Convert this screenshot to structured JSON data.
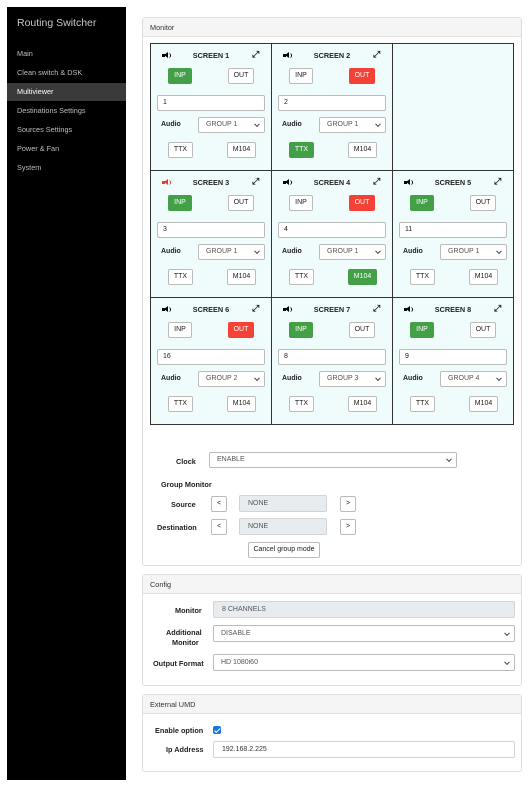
{
  "sidebar": {
    "brand": "Routing Switcher",
    "items": [
      {
        "label": "Main"
      },
      {
        "label": "Clean switch & DSK"
      },
      {
        "label": "Multiviewer"
      },
      {
        "label": "Destinations Settings"
      },
      {
        "label": "Sources Settings"
      },
      {
        "label": "Power & Fan"
      },
      {
        "label": "System"
      }
    ],
    "active_item": "Multiviewer"
  },
  "monitor": {
    "header": "Monitor",
    "inp_label": "INP",
    "out_label": "OUT",
    "audio_label": "Audio",
    "ttx_label": "TTX",
    "m104_label": "M104",
    "screens": [
      {
        "title": "SCREEN 1",
        "active": "INP",
        "channel": "1",
        "group": "GROUP 1",
        "ttx_on": false,
        "m104_on": false,
        "speaker_alert": false
      },
      {
        "title": "SCREEN 2",
        "active": "OUT",
        "channel": "2",
        "group": "GROUP 1",
        "ttx_on": true,
        "m104_on": false,
        "speaker_alert": false
      },
      {
        "title": "SCREEN 3",
        "active": "INP",
        "channel": "3",
        "group": "GROUP 1",
        "ttx_on": false,
        "m104_on": false,
        "speaker_alert": true
      },
      {
        "title": "SCREEN 4",
        "active": "OUT",
        "channel": "4",
        "group": "GROUP 1",
        "ttx_on": false,
        "m104_on": true,
        "speaker_alert": false
      },
      {
        "title": "SCREEN 5",
        "active": "INP",
        "channel": "11",
        "group": "GROUP 1",
        "ttx_on": false,
        "m104_on": false,
        "speaker_alert": false
      },
      {
        "title": "SCREEN 6",
        "active": "OUT",
        "channel": "16",
        "group": "GROUP 2",
        "ttx_on": false,
        "m104_on": false,
        "speaker_alert": false
      },
      {
        "title": "SCREEN 7",
        "active": "INP",
        "channel": "8",
        "group": "GROUP 3",
        "ttx_on": false,
        "m104_on": false,
        "speaker_alert": false
      },
      {
        "title": "SCREEN 8",
        "active": "INP",
        "channel": "9",
        "group": "GROUP 4",
        "ttx_on": false,
        "m104_on": false,
        "speaker_alert": false
      }
    ],
    "clock_label": "Clock",
    "clock_value": "ENABLE",
    "group_monitor_label": "Group Monitor",
    "source_label": "Source",
    "source_value": "NONE",
    "destination_label": "Destination",
    "destination_value": "NONE",
    "prev_label": "<",
    "next_label": ">",
    "cancel_label": "Cancel group mode"
  },
  "config": {
    "header": "Config",
    "monitor_label": "Monitor",
    "monitor_value": "8 CHANNELS",
    "additional_label_1": "Additional",
    "additional_label_2": "Monitor",
    "additional_value": "DISABLE",
    "output_label": "Output Format",
    "output_value": "HD 1080i60"
  },
  "umd": {
    "header": "External UMD",
    "enable_label": "Enable option",
    "enable_checked": true,
    "ip_label": "Ip Address",
    "ip_value": "192.168.2.225"
  },
  "colors": {
    "active_green": "#43a047",
    "active_red": "#f44336",
    "grid_background": "#f0fbfc",
    "sidebar": "#000000"
  },
  "icons": {
    "speaker": "speaker-icon",
    "expand": "expand-icon",
    "chevron": "chevron-down-icon",
    "checkbox": "checkbox-checked-icon"
  }
}
